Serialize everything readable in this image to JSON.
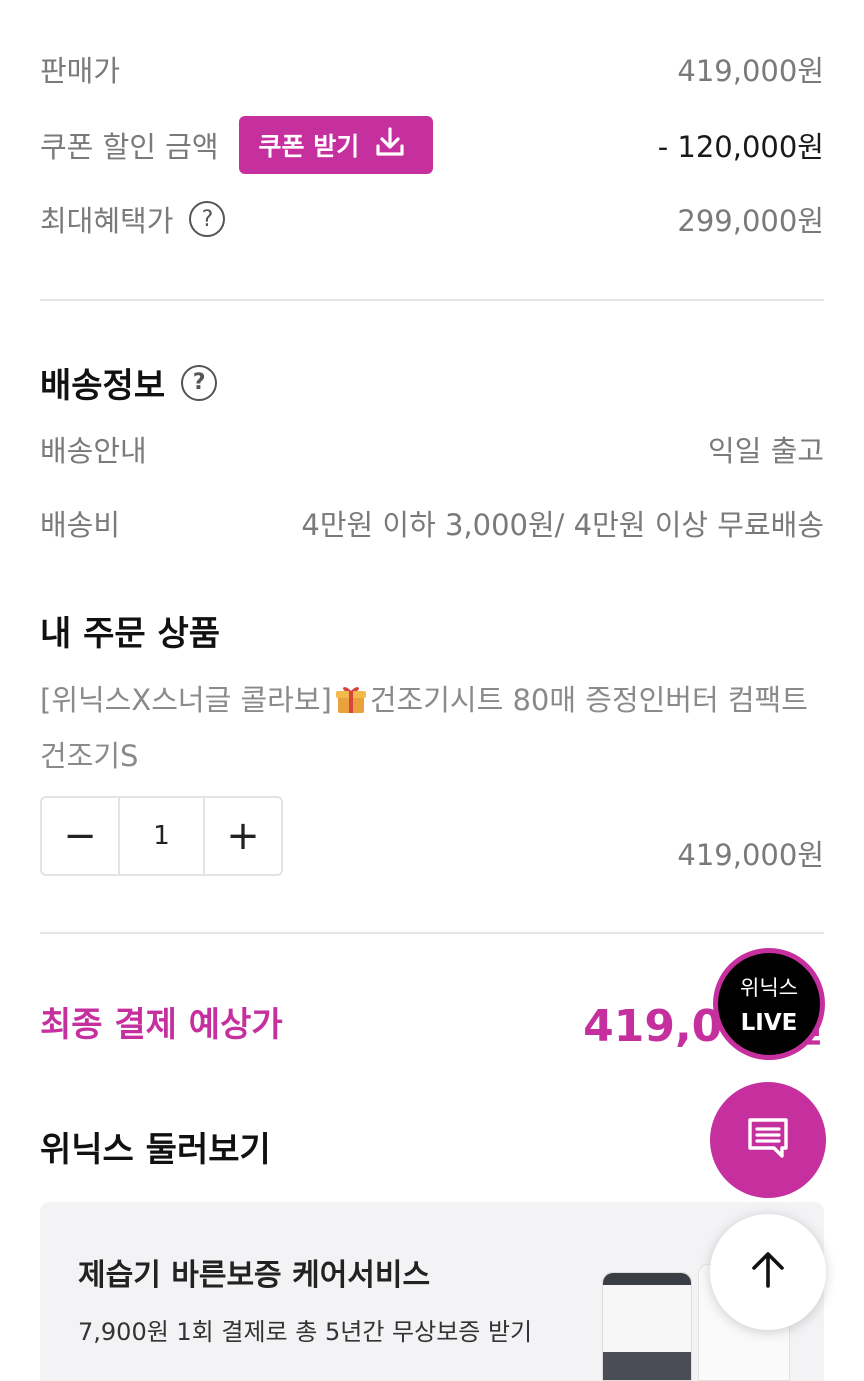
{
  "pricing": {
    "sale_price_label": "판매가",
    "sale_price_value": "419,000원",
    "coupon_label": "쿠폰 할인 금액",
    "coupon_button_label": "쿠폰 받기",
    "coupon_value": "- 120,000원",
    "max_benefit_label": "최대혜택가",
    "max_benefit_value": "299,000원",
    "help_glyph": "?"
  },
  "shipping": {
    "title": "배송정보",
    "guide_label": "배송안내",
    "guide_value": "익일 출고",
    "fee_label": "배송비",
    "fee_value": "4만원 이하 3,000원/ 4만원 이상 무료배송"
  },
  "order": {
    "title": "내 주문 상품",
    "product_name_part1": "[위닉스X스너글 콜라보]",
    "product_name_part2": "건조기시트 80매 증정인버터 컴팩트건조기S",
    "quantity": "1",
    "minus_glyph": "−",
    "plus_glyph": "+",
    "item_price": "419,000원"
  },
  "final": {
    "label": "최종 결제 예상가",
    "price": "419,000원"
  },
  "browse": {
    "title": "위닉스 둘러보기",
    "card_title": "제습기 바른보증 케어서비스",
    "card_desc": "7,900원 1회 결제로 총 5년간 무상보증 받기"
  },
  "floating": {
    "live_line1": "위닉스",
    "live_line2": "LIVE"
  },
  "colors": {
    "accent": "#c6309e"
  },
  "icons": [
    "download-icon",
    "help-circle-icon",
    "gift-icon",
    "chat-icon",
    "arrow-up-icon"
  ]
}
